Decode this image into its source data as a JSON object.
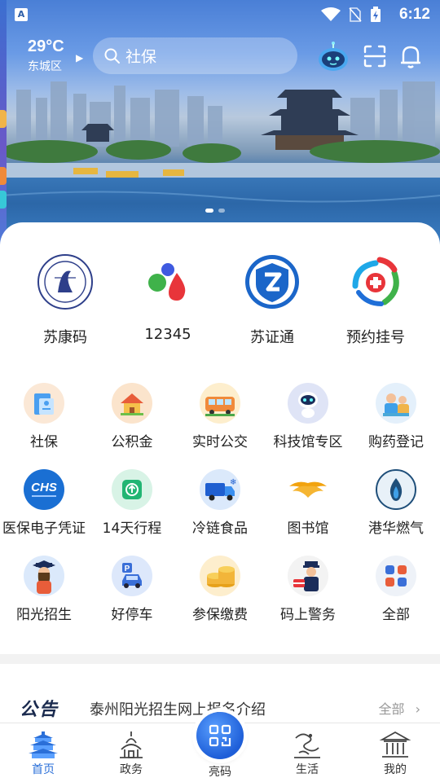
{
  "status_bar": {
    "time": "6:12"
  },
  "header": {
    "temperature": "29°C",
    "district": "东城区",
    "search_placeholder": "社保"
  },
  "banner": {
    "slide_count": 2,
    "active_slide": 0
  },
  "primary_services": [
    {
      "label": "苏康码",
      "icon": "su-kang-code-logo"
    },
    {
      "label": "12345",
      "icon": "hotline-12345-logo"
    },
    {
      "label": "苏证通",
      "icon": "su-zheng-tong-logo"
    },
    {
      "label": "预约挂号",
      "icon": "appointment-registration-logo"
    }
  ],
  "services": [
    {
      "label": "社保",
      "icon": "social-security-icon",
      "bg": "#fbe8d6"
    },
    {
      "label": "公积金",
      "icon": "housing-fund-icon",
      "bg": "#fbe4cc"
    },
    {
      "label": "实时公交",
      "icon": "bus-icon",
      "bg": "#fdeecd"
    },
    {
      "label": "科技馆专区",
      "icon": "robot-icon",
      "bg": "#dfe4f6"
    },
    {
      "label": "购药登记",
      "icon": "medicine-icon",
      "bg": "#e4f0fb"
    },
    {
      "label": "医保电子凭证",
      "icon": "chs-icon",
      "bg": "#1a6fd3"
    },
    {
      "label": "14天行程",
      "icon": "itinerary-icon",
      "bg": "#d8f3e6"
    },
    {
      "label": "冷链食品",
      "icon": "cold-chain-truck-icon",
      "bg": "#dbe9fb"
    },
    {
      "label": "图书馆",
      "icon": "library-icon",
      "bg": "#ffffff"
    },
    {
      "label": "港华燃气",
      "icon": "gas-flame-icon",
      "bg": "#e8f1f8"
    },
    {
      "label": "阳光招生",
      "icon": "graduate-icon",
      "bg": "#dbe9fb"
    },
    {
      "label": "好停车",
      "icon": "parking-icon",
      "bg": "#dde8fb"
    },
    {
      "label": "参保缴费",
      "icon": "coins-icon",
      "bg": "#fdeecd"
    },
    {
      "label": "码上警务",
      "icon": "police-icon",
      "bg": "#f3f3f3"
    },
    {
      "label": "全部",
      "icon": "all-apps-icon",
      "bg": "#eef2f8"
    }
  ],
  "notice": {
    "tag": "公告",
    "text": "泰州阳光招生网上报名介绍",
    "more": "全部"
  },
  "bottom_nav": [
    {
      "label": "首页",
      "icon": "home-tower-icon",
      "active": true
    },
    {
      "label": "政务",
      "icon": "government-icon",
      "active": false
    },
    {
      "label": "亮码",
      "icon": "qr-code-icon",
      "active": false
    },
    {
      "label": "生活",
      "icon": "dragon-icon",
      "active": false
    },
    {
      "label": "我的",
      "icon": "profile-building-icon",
      "active": false
    }
  ],
  "colors": {
    "accent": "#2a6fd8",
    "notice_tag": "#1a2a4e"
  }
}
